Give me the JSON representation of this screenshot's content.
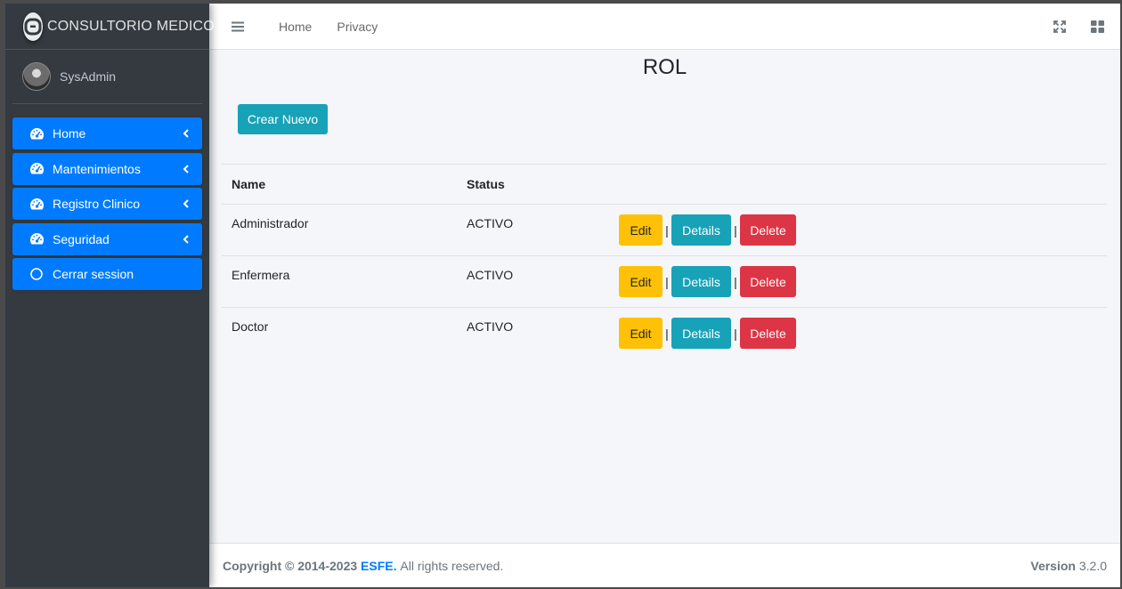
{
  "brand": {
    "name": "CONSULTORIO MEDICO",
    "logo_icon": "brand-logo-icon"
  },
  "user": {
    "name": "SysAdmin"
  },
  "sidebar": {
    "items": [
      {
        "label": "Home",
        "icon": "tachometer-icon",
        "has_chevron": true
      },
      {
        "label": "Mantenimientos",
        "icon": "tachometer-icon",
        "has_chevron": true
      },
      {
        "label": "Registro Clinico",
        "icon": "tachometer-icon",
        "has_chevron": true
      },
      {
        "label": "Seguridad",
        "icon": "tachometer-icon",
        "has_chevron": true
      },
      {
        "label": "Cerrar session",
        "icon": "circle-icon",
        "has_chevron": false
      }
    ]
  },
  "topbar": {
    "links": [
      "Home",
      "Privacy"
    ],
    "icons": [
      "fullscreen-icon",
      "grid-icon"
    ]
  },
  "page": {
    "title": "ROL",
    "create_label": "Crear Nuevo"
  },
  "table": {
    "headers": {
      "name": "Name",
      "status": "Status"
    },
    "rows": [
      {
        "name": "Administrador",
        "status": "ACTIVO"
      },
      {
        "name": "Enfermera",
        "status": "ACTIVO"
      },
      {
        "name": "Doctor",
        "status": "ACTIVO"
      }
    ],
    "actions": {
      "edit": "Edit",
      "details": "Details",
      "delete": "Delete",
      "separator": "|"
    }
  },
  "footer": {
    "copyright_prefix": "Copyright © 2014-2023",
    "org": "ESFE.",
    "rights": "All rights reserved.",
    "version_label": "Version",
    "version_value": "3.2.0"
  },
  "colors": {
    "sidebar_bg": "#343a40",
    "primary": "#007bff",
    "info": "#17a2b8",
    "warning": "#ffc107",
    "danger": "#dc3545",
    "content_bg": "#f4f6f9"
  }
}
